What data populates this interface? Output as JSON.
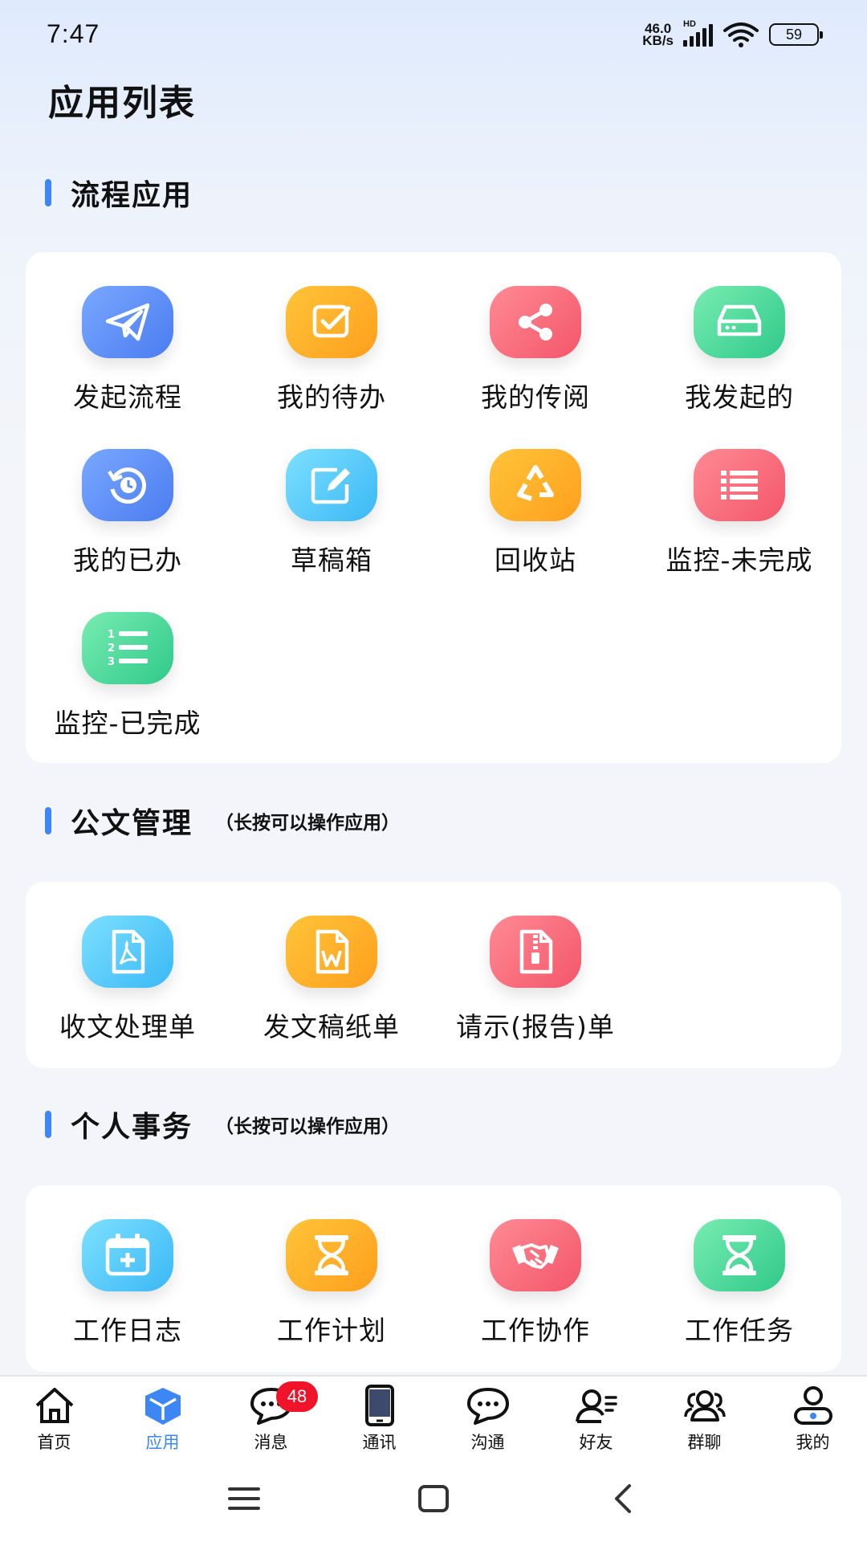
{
  "status_bar": {
    "time": "7:47",
    "net_speed_value": "46.0",
    "net_speed_unit": "KB/s",
    "network_type": "HD",
    "battery": "59"
  },
  "page_title": "应用列表",
  "sections": {
    "process": {
      "title": "流程应用",
      "apps": [
        {
          "label": "发起流程",
          "icon": "paper-plane-icon"
        },
        {
          "label": "我的待办",
          "icon": "checkbox-icon"
        },
        {
          "label": "我的传阅",
          "icon": "share-icon"
        },
        {
          "label": "我发起的",
          "icon": "drive-icon"
        },
        {
          "label": "我的已办",
          "icon": "history-icon"
        },
        {
          "label": "草稿箱",
          "icon": "edit-icon"
        },
        {
          "label": "回收站",
          "icon": "recycle-icon"
        },
        {
          "label": "监控-未完成",
          "icon": "list-icon"
        },
        {
          "label": "监控-已完成",
          "icon": "numbered-list-icon"
        }
      ]
    },
    "documents": {
      "title": "公文管理",
      "hint": "（长按可以操作应用）",
      "apps": [
        {
          "label": "收文处理单",
          "icon": "pdf-file-icon"
        },
        {
          "label": "发文稿纸单",
          "icon": "word-file-icon"
        },
        {
          "label": "请示(报告)单",
          "icon": "zip-file-icon"
        }
      ]
    },
    "personal": {
      "title": "个人事务",
      "hint": "（长按可以操作应用）",
      "apps": [
        {
          "label": "工作日志",
          "icon": "calendar-add-icon"
        },
        {
          "label": "工作计划",
          "icon": "hourglass-icon"
        },
        {
          "label": "工作协作",
          "icon": "handshake-icon"
        },
        {
          "label": "工作任务",
          "icon": "hourglass-icon"
        }
      ]
    }
  },
  "bottom_nav": {
    "items": [
      {
        "label": "首页",
        "icon": "home-icon"
      },
      {
        "label": "应用",
        "icon": "cube-icon"
      },
      {
        "label": "消息",
        "icon": "chat-icon",
        "badge": "48"
      },
      {
        "label": "通讯",
        "icon": "phone-icon"
      },
      {
        "label": "沟通",
        "icon": "chat-bubble-icon"
      },
      {
        "label": "好友",
        "icon": "friend-icon"
      },
      {
        "label": "群聊",
        "icon": "group-icon"
      },
      {
        "label": "我的",
        "icon": "user-icon"
      }
    ],
    "active_index": 1
  },
  "colors": {
    "accent": "#3d86f5",
    "badge": "#f0142a"
  }
}
